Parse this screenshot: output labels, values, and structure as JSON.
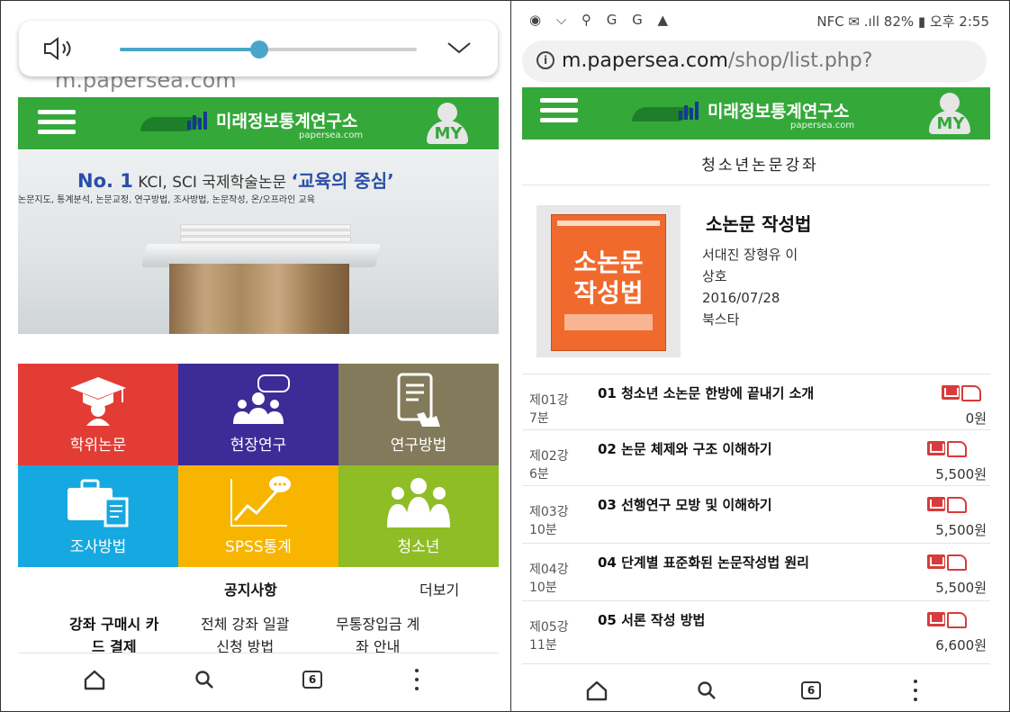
{
  "left": {
    "url_peek": "m.papersea.com",
    "volume_level": 0.47,
    "brand": {
      "name": "미래정보통계연구소",
      "sub": "papersea.com",
      "my": "MY"
    },
    "hero": {
      "no": "No. 1",
      "line1_mid": " KCI, SCI 국제학술논문 ",
      "line1_hl": "‘교육의 중심’",
      "line2": "논문지도, 통계분석, 논문교정, 연구방법, 조사방법, 논문작성, 온/오프라인 교육"
    },
    "tiles": [
      {
        "label": "학위논문",
        "icon": "graduation-icon",
        "color": "#e23c35"
      },
      {
        "label": "현장연구",
        "icon": "group-chat-icon",
        "color": "#3d2b98"
      },
      {
        "label": "연구방법",
        "icon": "tablet-touch-icon",
        "color": "#827a5a"
      },
      {
        "label": "조사방법",
        "icon": "briefcase-doc-icon",
        "color": "#16a8e0"
      },
      {
        "label": "SPSS통계",
        "icon": "chart-trend-icon",
        "color": "#f7b500"
      },
      {
        "label": "청소년",
        "icon": "people-icon",
        "color": "#8fbd26"
      }
    ],
    "notice": {
      "title": "공지사항",
      "more": "더보기",
      "items": [
        {
          "l1": "강좌 구매시 카",
          "l2": "드 결제"
        },
        {
          "l1": "전체 강좌 일괄",
          "l2": "신청 방법"
        },
        {
          "l1": "무통장입금 계",
          "l2": "좌 안내"
        }
      ]
    },
    "nav": {
      "tabs_count": "6"
    }
  },
  "right": {
    "status": {
      "left_icons": "◉ ⌵ ⚲ G G ▲",
      "right": "NFC ✉ .ıll 82% ▮ 오후 2:55"
    },
    "url": {
      "host": "m.papersea.com",
      "path": "/shop/list.php?"
    },
    "brand": {
      "name": "미래정보통계연구소",
      "sub": "papersea.com",
      "my": "MY"
    },
    "page_title": "청소년논문강좌",
    "book": {
      "cover_text_l1": "소논문",
      "cover_text_l2": "작성법",
      "title": "소논문 작성법",
      "authors_l1": "서대진 장형유 이",
      "authors_l2": "상호",
      "date": "2016/07/28",
      "publisher": "북스타"
    },
    "lectures": [
      {
        "no": "제01강",
        "min": "7분",
        "title": "01 청소년 소논문 한방에 끝내기 소개",
        "price": "0원"
      },
      {
        "no": "제02강",
        "min": "6분",
        "title": "02 논문 체제와 구조 이해하기",
        "price": "5,500원"
      },
      {
        "no": "제03강",
        "min": "10분",
        "title": "03 선행연구 모방 및 이해하기",
        "price": "5,500원"
      },
      {
        "no": "제04강",
        "min": "10분",
        "title": "04 단계별 표준화된 논문작성법 원리",
        "price": "5,500원"
      },
      {
        "no": "제05강",
        "min": "11분",
        "title": "05 서론 작성 방법",
        "price": "6,600원"
      }
    ],
    "nav": {
      "tabs_count": "6"
    }
  }
}
